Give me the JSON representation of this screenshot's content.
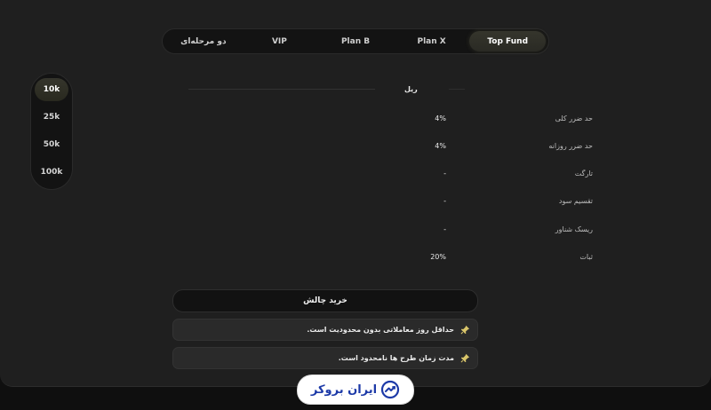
{
  "tabs": [
    {
      "label": "Top Fund",
      "active": true
    },
    {
      "label": "Plan X",
      "active": false
    },
    {
      "label": "Plan B",
      "active": false
    },
    {
      "label": "VIP",
      "active": false
    },
    {
      "label": "دو مرحله‌ای",
      "active": false
    }
  ],
  "sizes": [
    {
      "label": "10k",
      "active": true
    },
    {
      "label": "25k",
      "active": false
    },
    {
      "label": "50k",
      "active": false
    },
    {
      "label": "100k",
      "active": false
    }
  ],
  "table": {
    "currency": "ریل",
    "rows": [
      {
        "label": "حد ضرر کلی",
        "value": "4%"
      },
      {
        "label": "حد ضرر روزانه",
        "value": "4%"
      },
      {
        "label": "تارگت",
        "value": "-"
      },
      {
        "label": "تقسیم سود",
        "value": "-"
      },
      {
        "label": "ریسک شناور",
        "value": "-"
      },
      {
        "label": "ثبات",
        "value": "20%"
      }
    ]
  },
  "buy_label": "خرید چالش",
  "notes": [
    "حداقل روز معاملاتی بدون محدودیت است.",
    "مدت زمان طرح ها نامحدود است."
  ],
  "brand": {
    "name": "ایران بروکر",
    "color": "#1d3aa8"
  },
  "colors": {
    "accent_active": "#2f2f27",
    "background": "#1f1f1f"
  }
}
